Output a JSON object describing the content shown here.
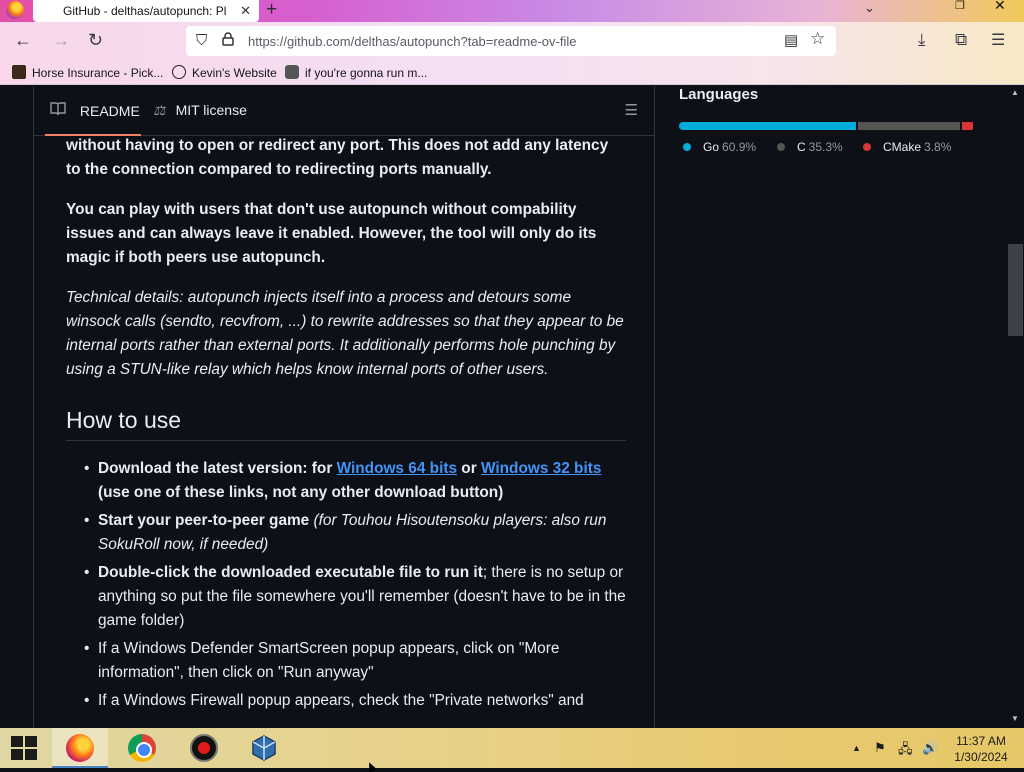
{
  "browser": {
    "tab_title": "GitHub - delthas/autopunch: Pl",
    "tab_close": "✕",
    "new_tab": "+",
    "list_all_tabs": "⌄",
    "url": "https://github.com/delthas/autopunch?tab=readme-ov-file",
    "nav": {
      "back": "←",
      "forward": "→",
      "reload": "↻"
    },
    "icons": {
      "downloads": "⤓",
      "extensions": "⧉",
      "menu": "☰",
      "reader": "▤",
      "bookmark": "☆",
      "shield": "⛉",
      "lock": "🔒"
    },
    "bookmarks": [
      {
        "label": "Horse Insurance - Pick..."
      },
      {
        "label": "Kevin's Website"
      },
      {
        "label": "if you're gonna run m..."
      }
    ]
  },
  "readme": {
    "tabs": [
      {
        "label": "README",
        "icon": "book-icon"
      },
      {
        "label": "MIT license",
        "icon": "scale-icon"
      }
    ],
    "toc_icon": "☰",
    "para1": "This program lets you host & connect to friends to play peer-to-peer games without having to open or redirect any port. This does not add any latency to the connection compared to redirecting ports manually.",
    "para2": "You can play with users that don't use autopunch without compability issues and can always leave it enabled. However, the tool will only do its magic if both peers use autopunch.",
    "para3": "Technical details: autopunch injects itself into a process and detours some winsock calls (sendto, recvfrom, ...) to rewrite addresses so that they appear to be internal ports rather than external ports. It additionally performs hole punching by using a STUN-like relay which helps know internal ports of other users.",
    "howto_heading": "How to use",
    "steps": {
      "s1_a": "Download the latest version: for ",
      "s1_link1": "Windows 64 bits",
      "s1_or": " or ",
      "s1_link2": "Windows 32 bits",
      "s1_b": "(use one of these links, not any other download button)",
      "s2_a": "Start your peer-to-peer game",
      "s2_b": " (for Touhou Hisoutensoku players: also run SokuRoll now, if needed)",
      "s3_a": "Double-click the downloaded executable file to run it",
      "s3_b": "; there is no setup or anything so put the file somewhere you'll remember (doesn't have to be in the game folder)",
      "s4": "If a Windows Defender SmartScreen popup appears, click on \"More information\", then click on \"Run anyway\"",
      "s5": "If a Windows Firewall popup appears, check the \"Private networks\" and"
    }
  },
  "sidebar": {
    "languages_title": "Languages",
    "languages": [
      {
        "name": "Go",
        "percent": "60.9%",
        "share": 60.9,
        "color": "#00add8"
      },
      {
        "name": "C",
        "percent": "35.3%",
        "share": 35.3,
        "color": "#555555"
      },
      {
        "name": "CMake",
        "percent": "3.8%",
        "share": 3.8,
        "color": "#da3434"
      }
    ]
  },
  "taskbar": {
    "apps": [
      {
        "name": "Firefox",
        "active": true
      },
      {
        "name": "Google Chrome",
        "active": false
      },
      {
        "name": "OBS Studio",
        "active": false
      },
      {
        "name": "VirtualBox",
        "active": false
      }
    ],
    "tray": {
      "chevron": "▲",
      "flag": "⚑",
      "network": "🖧",
      "volume": "🔊"
    },
    "time": "11:37 AM",
    "date": "1/30/2024"
  },
  "colors": {
    "page_bg": "#0d1117",
    "text": "#e6edf3",
    "link": "#4493f8",
    "accent_underline": "#f78166",
    "border": "#30363d"
  }
}
